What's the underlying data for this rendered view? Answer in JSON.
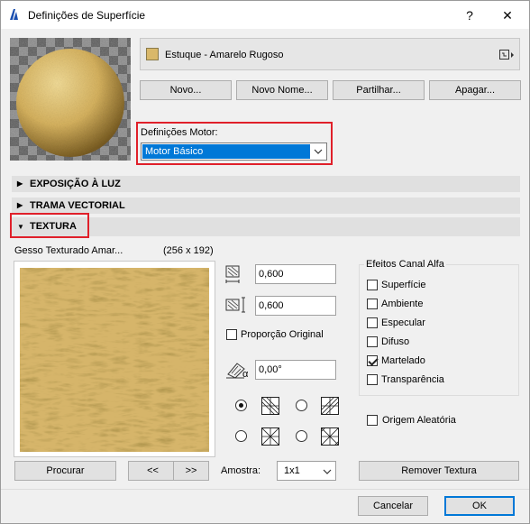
{
  "window": {
    "title": "Definições de Superfície",
    "help_label": "?",
    "close_label": "✕"
  },
  "surface": {
    "name": "Estuque - Amarelo Rugoso",
    "swatch_color": "#d9b86a"
  },
  "buttons": {
    "new": "Novo...",
    "new_name": "Novo Nome...",
    "share": "Partilhar...",
    "delete": "Apagar..."
  },
  "engine": {
    "label": "Definições Motor:",
    "value": "Motor Básico"
  },
  "sections": {
    "light": "EXPOSIÇÃO À LUZ",
    "vector": "TRAMA VECTORIAL",
    "texture": "TEXTURA"
  },
  "texture": {
    "name": "Gesso Texturado Amar...",
    "size": "(256 x 192)",
    "width": "0,600",
    "height": "0,600",
    "keep_ratio_label": "Proporção Original",
    "keep_ratio_checked": false,
    "angle": "0,00°",
    "angle_symbol": "α",
    "browse": "Procurar",
    "prev": "<<",
    "next": ">>",
    "sample_label": "Amostra:",
    "sample_value": "1x1",
    "remove": "Remover Textura",
    "random_origin_label": "Origem Aleatória",
    "random_origin_checked": false
  },
  "alpha": {
    "title": "Efeitos Canal Alfa",
    "items": [
      {
        "label": "Superfície",
        "checked": false
      },
      {
        "label": "Ambiente",
        "checked": false
      },
      {
        "label": "Especular",
        "checked": false
      },
      {
        "label": "Difuso",
        "checked": false
      },
      {
        "label": "Martelado",
        "checked": true
      },
      {
        "label": "Transparência",
        "checked": false
      }
    ]
  },
  "footer": {
    "cancel": "Cancelar",
    "ok": "OK"
  },
  "colors": {
    "accent": "#0078d7",
    "highlight_box": "#e0202a",
    "texture_base": "#d9b86a"
  }
}
